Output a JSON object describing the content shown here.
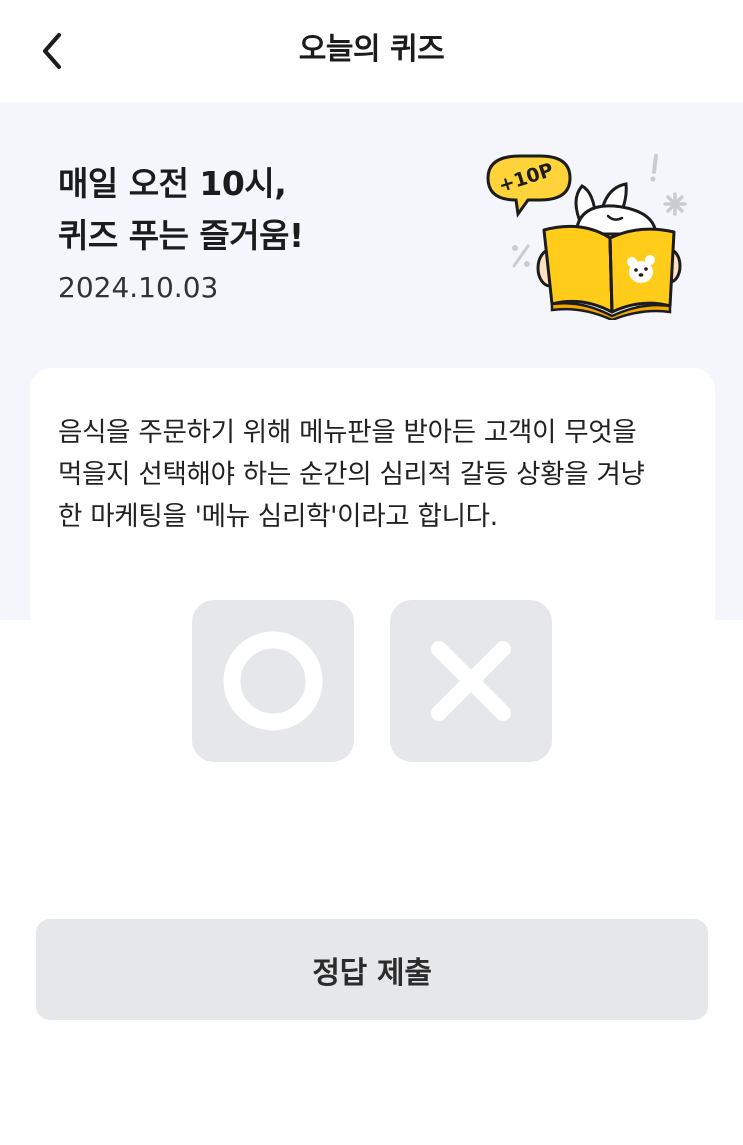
{
  "header": {
    "title": "오늘의 퀴즈",
    "back_icon": "chevron-left-icon"
  },
  "hero": {
    "title_line1": "매일 오전 10시,",
    "title_line2": "퀴즈 푸는 즐거움!",
    "date": "2024.10.03",
    "badge_text": "+10P",
    "colors": {
      "background": "#f4f6fb",
      "badge": "#ffd43b",
      "book": "#ffcc1a"
    }
  },
  "quiz": {
    "question_lines": [
      "음식을 주문하기 위해 메뉴판을 받아든 고객이 무엇을",
      "먹을지 선택해야 하는 순간의 심리적 갈등 상황을 겨냥",
      "한 마케팅을 '메뉴 심리학'이라고 합니다."
    ],
    "options": [
      {
        "icon": "o-mark-icon",
        "value": "O"
      },
      {
        "icon": "x-mark-icon",
        "value": "X"
      }
    ]
  },
  "submit": {
    "label": "정답 제출"
  }
}
